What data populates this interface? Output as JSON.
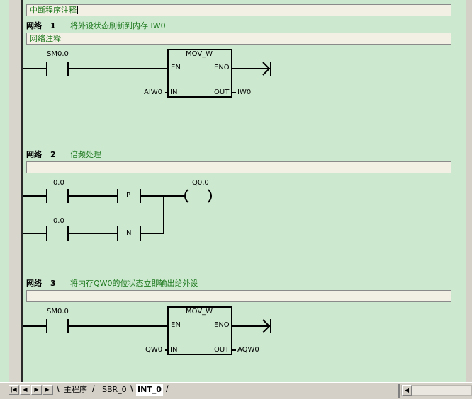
{
  "program_comment": "中断程序注释",
  "networks": [
    {
      "title": "网络",
      "number": "1",
      "comment": "将外设状态刷新到内存 IW0",
      "comment_box": "网络注释",
      "contact": "SM0.0",
      "box": {
        "name": "MOV_W",
        "en": "EN",
        "eno": "ENO",
        "in": "IN",
        "out": "OUT",
        "in_operand": "AIW0",
        "out_operand": "IW0"
      }
    },
    {
      "title": "网络",
      "number": "2",
      "comment": "倍频处理",
      "comment_box": "",
      "contact_top": "I0.0",
      "contact_bottom": "I0.0",
      "p_label": "P",
      "n_label": "N",
      "coil": "Q0.0"
    },
    {
      "title": "网络",
      "number": "3",
      "comment": "将内存QW0的位状态立即输出给外设",
      "comment_box": "",
      "contact": "SM0.0",
      "box": {
        "name": "MOV_W",
        "en": "EN",
        "eno": "ENO",
        "in": "IN",
        "out": "OUT",
        "in_operand": "QW0",
        "out_operand": "AQW0"
      }
    }
  ],
  "tabs": [
    {
      "label": "主程序",
      "active": false
    },
    {
      "label": "SBR_0",
      "active": false
    },
    {
      "label": "INT_0",
      "active": true
    }
  ],
  "nav_buttons": [
    "first-icon",
    "prev-icon",
    "next-icon",
    "last-icon"
  ]
}
